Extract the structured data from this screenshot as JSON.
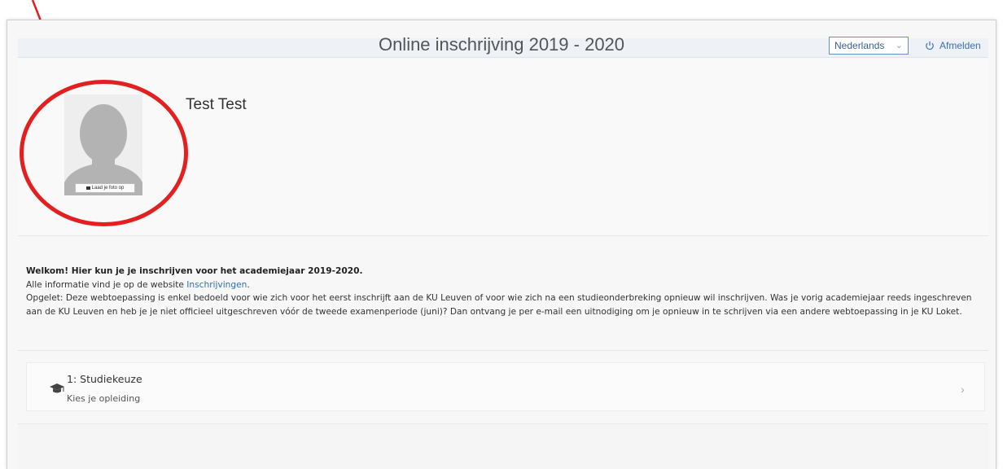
{
  "header": {
    "title": "Online inschrijving 2019 - 2020",
    "language": "Nederlands",
    "logout_label": "Afmelden"
  },
  "profile": {
    "name": "Test Test",
    "upload_photo_label": "Laad je foto op"
  },
  "info": {
    "welcome": "Welkom! Hier kun je je inschrijven voor het academiejaar 2019-2020.",
    "line2_prefix": "Alle informatie vind je op de website ",
    "line2_link": "Inschrijvingen",
    "line2_suffix": ".",
    "warning": "Opgelet: Deze webtoepassing is enkel bedoeld voor wie zich voor het eerst inschrijft aan de KU Leuven of voor wie zich na een studieonderbreking opnieuw wil inschrijven. Was je vorig academiejaar reeds ingeschreven aan de KU Leuven en heb je je niet officieel uitgeschreven vóór de tweede examenperiode (juni)? Dan ontvang je per e-mail een uitnodiging om je opnieuw in te schrijven via een andere webtoepassing in je KU Loket."
  },
  "steps": [
    {
      "title": "1: Studiekeuze",
      "subtitle": "Kies je opleiding",
      "icon": "graduation-cap-icon"
    }
  ],
  "colors": {
    "annotation_red": "#e41f1f",
    "link_blue": "#2f6fb7",
    "header_bg": "#eef1f6"
  }
}
